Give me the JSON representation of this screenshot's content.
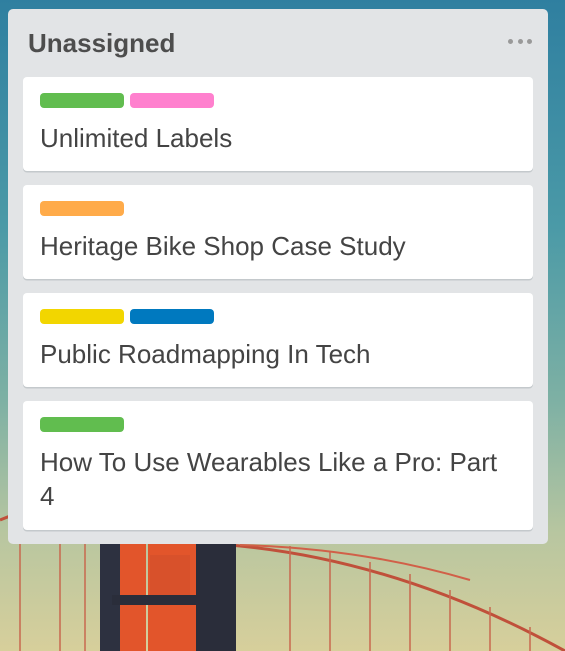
{
  "list": {
    "title": "Unassigned",
    "menu_icon": "ellipsis-icon",
    "cards": [
      {
        "title": "Unlimited Labels",
        "labels": [
          {
            "color_name": "green",
            "color": "#61bd4f"
          },
          {
            "color_name": "pink",
            "color": "#ff80ce"
          }
        ]
      },
      {
        "title": "Heritage Bike Shop Case Study",
        "labels": [
          {
            "color_name": "orange",
            "color": "#ffab4a"
          }
        ]
      },
      {
        "title": "Public Roadmapping In Tech",
        "labels": [
          {
            "color_name": "yellow",
            "color": "#f2d600"
          },
          {
            "color_name": "blue",
            "color": "#0079bf"
          }
        ]
      },
      {
        "title": "How To Use Wearables Like a Pro: Part 4",
        "labels": [
          {
            "color_name": "green",
            "color": "#61bd4f"
          }
        ]
      }
    ]
  },
  "colors": {
    "list_background": "#e2e4e6",
    "card_background": "#ffffff",
    "bridge": "#e2552b"
  }
}
